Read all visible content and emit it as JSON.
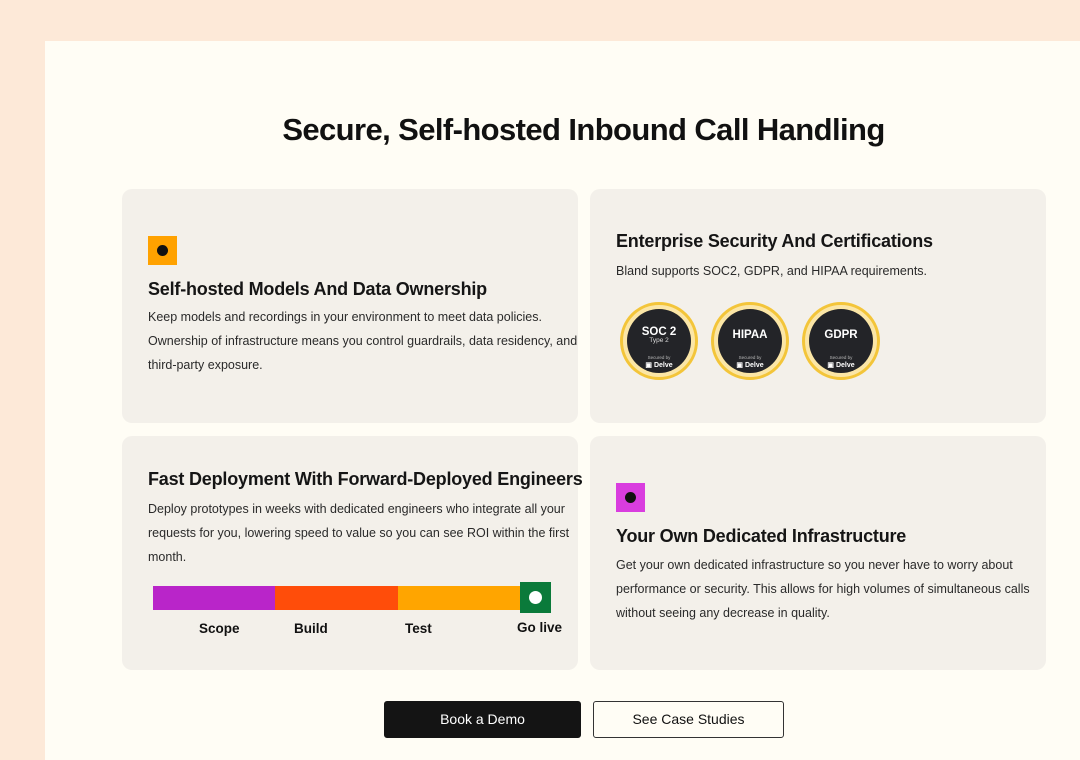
{
  "page": {
    "title": "Secure, Self-hosted Inbound Call Handling"
  },
  "colors": {
    "background_outer": "#fde9d8",
    "panel": "#fffdf5",
    "card": "#f3f0ea",
    "icon_orange": "#ffa200",
    "icon_magenta": "#d93ddf",
    "scope": "#b925c9",
    "build": "#ff4d0a",
    "test": "#ffa500",
    "go_live": "#0a7a3a"
  },
  "cards": {
    "self_hosted": {
      "icon": "orange-square-dot-icon",
      "title": "Self-hosted Models And Data Ownership",
      "line1": "Keep models and recordings in your environment to meet data policies.",
      "line2": "Ownership of infrastructure means you control guardrails, data residency, and",
      "line3": "third-party exposure."
    },
    "security": {
      "title": "Enterprise Security And Certifications",
      "text": "Bland supports SOC2, GDPR, and HIPAA requirements.",
      "badges": [
        {
          "name": "SOC 2",
          "sub": "Type 2",
          "secured": "Secured by",
          "brand": "Delve"
        },
        {
          "name": "HIPAA",
          "sub": "",
          "secured": "Secured by",
          "brand": "Delve"
        },
        {
          "name": "GDPR",
          "sub": "",
          "secured": "Secured by",
          "brand": "Delve"
        }
      ]
    },
    "deployment": {
      "title": "Fast Deployment With Forward-Deployed Engineers",
      "line1": "Deploy prototypes in weeks with dedicated engineers who integrate all your",
      "line2": "requests for you, lowering speed to value so you can see ROI within the first",
      "line3": "month.",
      "timeline": {
        "scope": "Scope",
        "build": "Build",
        "test": "Test",
        "go_live": "Go live"
      }
    },
    "infrastructure": {
      "icon": "magenta-square-dot-icon",
      "title": "Your Own Dedicated Infrastructure",
      "line1": "Get your own dedicated infrastructure so you never have to worry about",
      "line2": "performance or security. This allows for high volumes of simultaneous calls",
      "line3": "without seeing any decrease in quality."
    }
  },
  "buttons": {
    "book_demo": "Book a Demo",
    "case_studies": "See Case Studies"
  }
}
